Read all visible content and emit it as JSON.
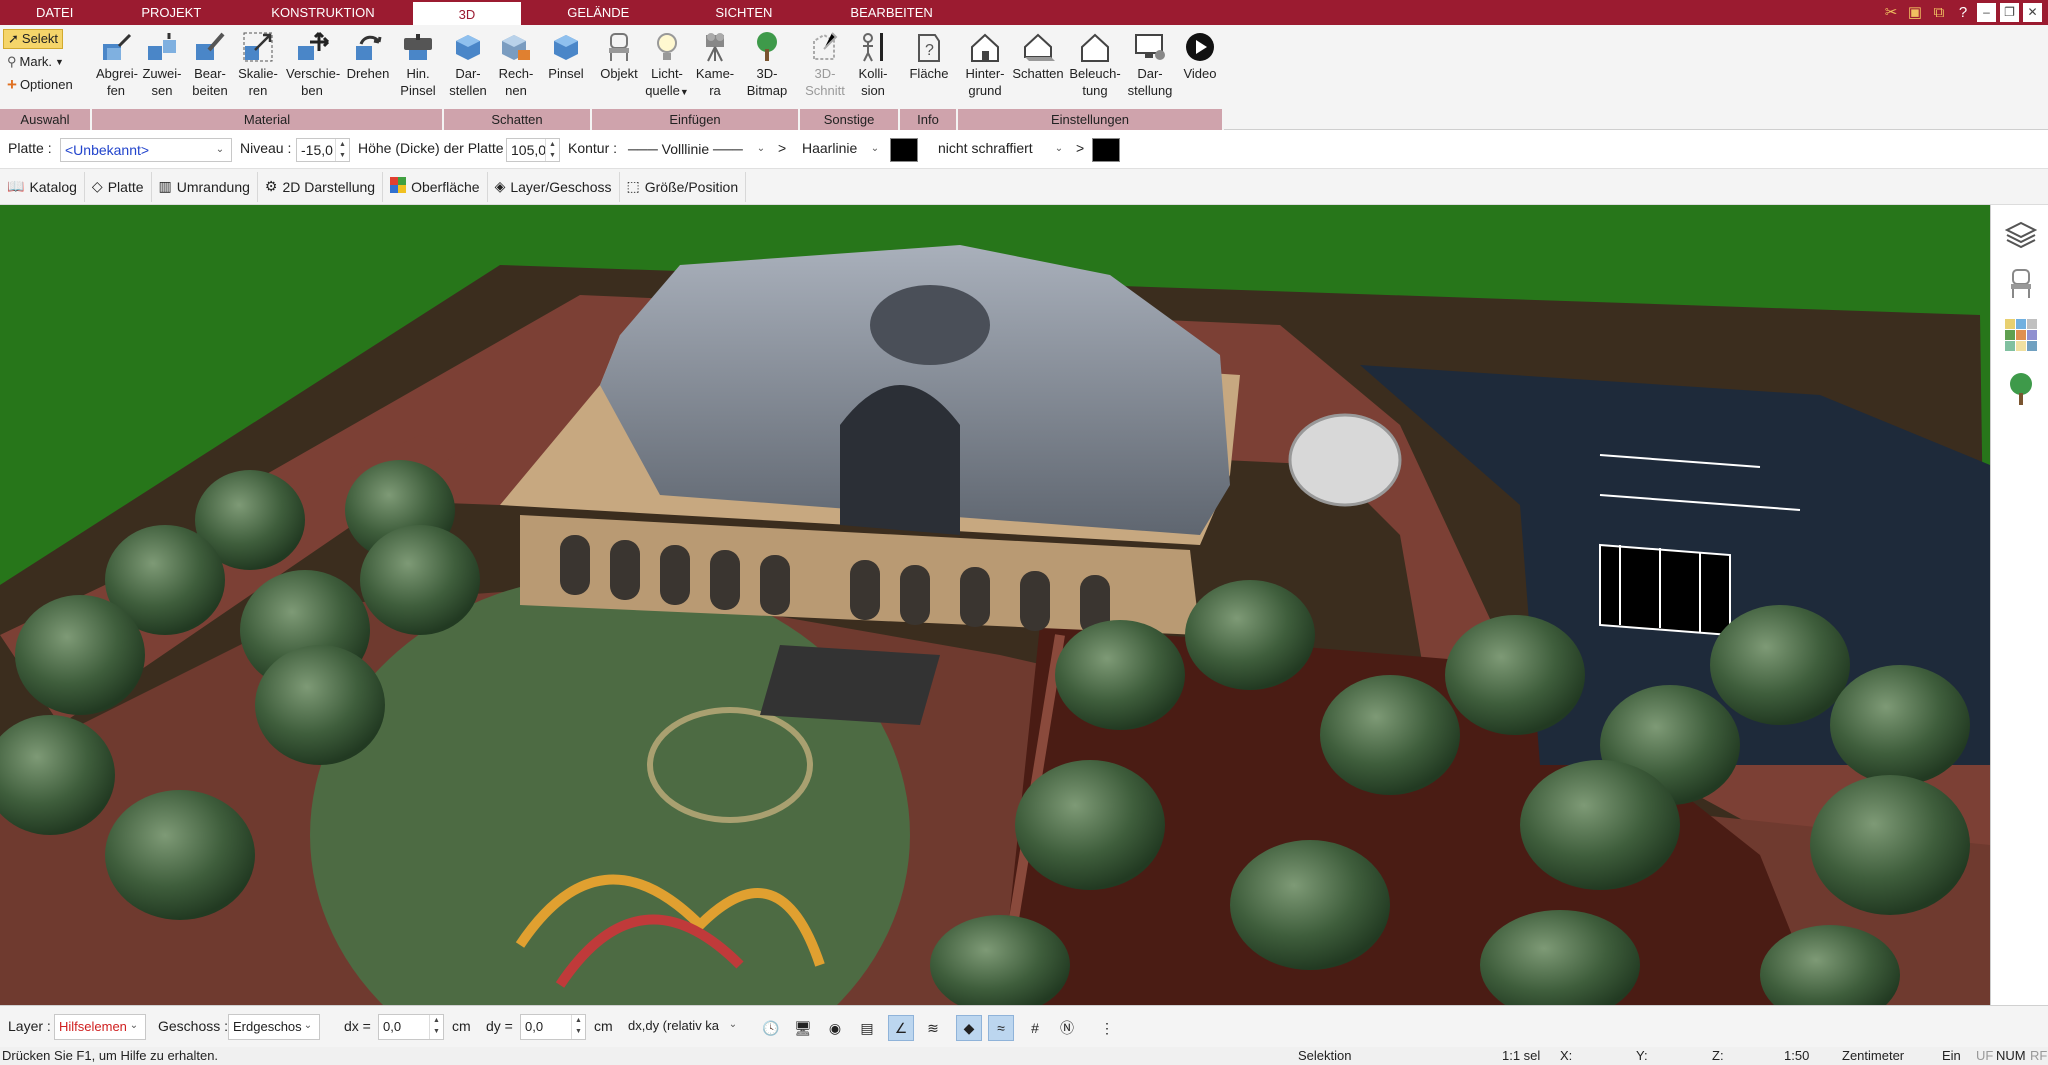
{
  "tabs": [
    "DATEI",
    "PROJEKT",
    "KONSTRUKTION",
    "3D",
    "GELÄNDE",
    "SICHTEN",
    "BEARBEITEN"
  ],
  "ribbon": {
    "auswahl": {
      "selekt": "Selekt",
      "mark": "Mark.",
      "optionen": "Optionen",
      "label": "Auswahl"
    },
    "material": {
      "label": "Material",
      "buttons": [
        {
          "l1": "Abgrei-",
          "l2": "fen"
        },
        {
          "l1": "Zuwei-",
          "l2": "sen"
        },
        {
          "l1": "Bear-",
          "l2": "beiten"
        },
        {
          "l1": "Skalie-",
          "l2": "ren"
        },
        {
          "l1": "Verschie-",
          "l2": "ben"
        },
        {
          "l1": "Drehen",
          "l2": ""
        },
        {
          "l1": "Hin.",
          "l2": "Pinsel"
        }
      ]
    },
    "schatten": {
      "label": "Schatten",
      "buttons": [
        {
          "l1": "Dar-",
          "l2": "stellen"
        },
        {
          "l1": "Rech-",
          "l2": "nen"
        },
        {
          "l1": "Pinsel",
          "l2": ""
        }
      ]
    },
    "einfuegen": {
      "label": "Einfügen",
      "buttons": [
        {
          "l1": "Objekt",
          "l2": ""
        },
        {
          "l1": "Licht-",
          "l2": "quelle"
        },
        {
          "l1": "Kame-",
          "l2": "ra"
        },
        {
          "l1": "3D-",
          "l2": "Bitmap"
        }
      ]
    },
    "sonstige": {
      "label": "Sonstige",
      "buttons": [
        {
          "l1": "3D-",
          "l2": "Schnitt"
        },
        {
          "l1": "Kolli-",
          "l2": "sion"
        }
      ]
    },
    "info": {
      "label": "Info",
      "buttons": [
        {
          "l1": "Fläche",
          "l2": ""
        }
      ]
    },
    "einstellungen": {
      "label": "Einstellungen",
      "buttons": [
        {
          "l1": "Hinter-",
          "l2": "grund"
        },
        {
          "l1": "Schatten",
          "l2": ""
        },
        {
          "l1": "Beleuch-",
          "l2": "tung"
        },
        {
          "l1": "Dar-",
          "l2": "stellung"
        },
        {
          "l1": "Video",
          "l2": ""
        }
      ]
    }
  },
  "propbar": {
    "platte_label": "Platte :",
    "platte_value": "<Unbekannt>",
    "niveau_label": "Niveau :",
    "niveau_value": "-15,0",
    "hoehe_label": "Höhe (Dicke) der Platte",
    "hoehe_value": "105,0",
    "kontur_label": "Kontur :",
    "kontur_value": "Volllinie",
    "gt1": ">",
    "haarlinie": "Haarlinie",
    "schraffur": "nicht schraffiert",
    "gt2": ">"
  },
  "tools": [
    "Katalog",
    "Platte",
    "Umrandung",
    "2D Darstellung",
    "Oberfläche",
    "Layer/Geschoss",
    "Größe/Position"
  ],
  "bottombar": {
    "layer_label": "Layer :",
    "layer_value": "Hilfselemen",
    "geschoss_label": "Geschoss :",
    "geschoss_value": "Erdgeschos",
    "dx_label": "dx =",
    "dx_value": "0,0",
    "dx_unit": "cm",
    "dy_label": "dy =",
    "dy_value": "0,0",
    "dy_unit": "cm",
    "mode_value": "dx,dy (relativ ka"
  },
  "status": {
    "help": "Drücken Sie F1, um Hilfe zu erhalten.",
    "mode": "Selektion",
    "sel": "1:1 sel",
    "x": "X:",
    "y": "Y:",
    "z": "Z:",
    "scale": "1:50",
    "unit": "Zentimeter",
    "ein": "Ein",
    "uf": "UF",
    "num": "NUM",
    "rf": "RF"
  },
  "colors": {
    "accent": "#9b1b30",
    "group_label": "#cfa3ac",
    "lawn": "#2a7a18",
    "paving": "#7a3e33",
    "soil": "#4a1c14",
    "asphalt": "#1e2a3a"
  }
}
